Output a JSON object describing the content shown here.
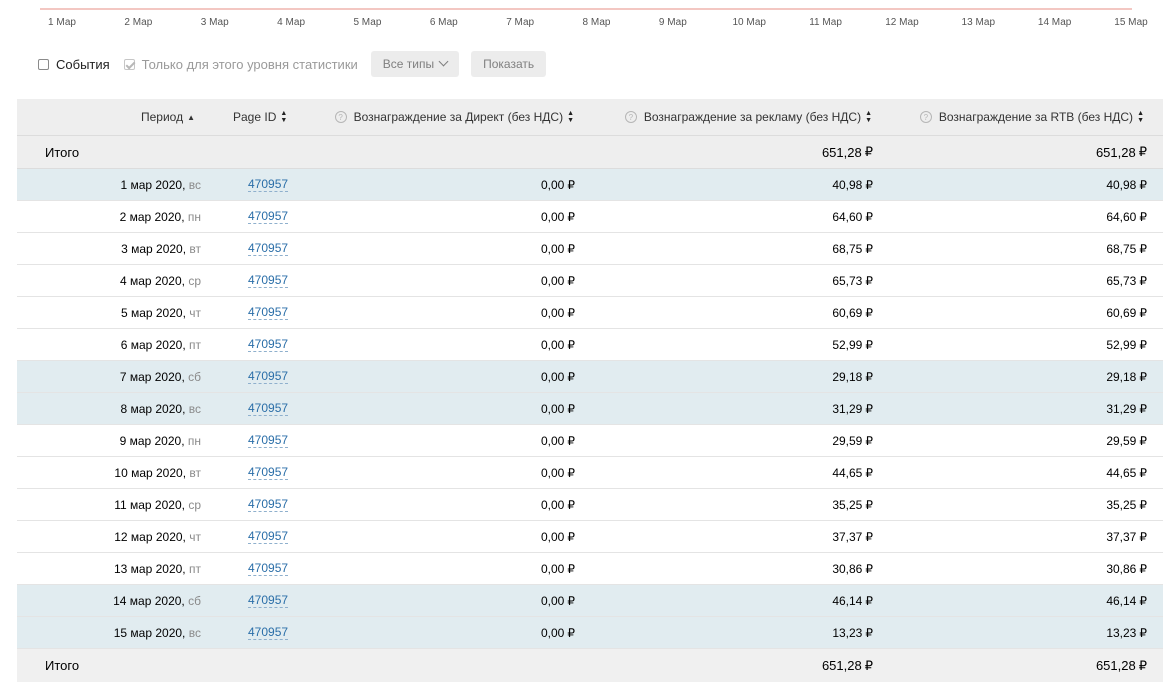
{
  "chart_axis": {
    "ticks": [
      "1 Мар",
      "2 Мар",
      "3 Мар",
      "4 Мар",
      "5 Мар",
      "6 Мар",
      "7 Мар",
      "8 Мар",
      "9 Мар",
      "10 Мар",
      "11 Мар",
      "12 Мар",
      "13 Мар",
      "14 Мар",
      "15 Мар"
    ]
  },
  "controls": {
    "events_label": "События",
    "only_level_label": "Только для этого уровня статистики",
    "types_button": "Все типы",
    "show_button": "Показать"
  },
  "table": {
    "headers": {
      "period": "Период",
      "page_id": "Page ID",
      "direct": "Вознаграждение за Директ (без НДС)",
      "ads": "Вознаграждение за рекламу (без НДС)",
      "rtb": "Вознаграждение за RTB (без НДС)"
    },
    "currency": "₽",
    "total": {
      "label": "Итого",
      "direct": "",
      "ads": "651,28",
      "rtb": "651,28"
    },
    "rows": [
      {
        "date": "1 мар 2020,",
        "day": "вс",
        "page_id": "470957",
        "direct": "0,00",
        "ads": "40,98",
        "rtb": "40,98",
        "weekend": true
      },
      {
        "date": "2 мар 2020,",
        "day": "пн",
        "page_id": "470957",
        "direct": "0,00",
        "ads": "64,60",
        "rtb": "64,60",
        "weekend": false
      },
      {
        "date": "3 мар 2020,",
        "day": "вт",
        "page_id": "470957",
        "direct": "0,00",
        "ads": "68,75",
        "rtb": "68,75",
        "weekend": false
      },
      {
        "date": "4 мар 2020,",
        "day": "ср",
        "page_id": "470957",
        "direct": "0,00",
        "ads": "65,73",
        "rtb": "65,73",
        "weekend": false
      },
      {
        "date": "5 мар 2020,",
        "day": "чт",
        "page_id": "470957",
        "direct": "0,00",
        "ads": "60,69",
        "rtb": "60,69",
        "weekend": false
      },
      {
        "date": "6 мар 2020,",
        "day": "пт",
        "page_id": "470957",
        "direct": "0,00",
        "ads": "52,99",
        "rtb": "52,99",
        "weekend": false
      },
      {
        "date": "7 мар 2020,",
        "day": "сб",
        "page_id": "470957",
        "direct": "0,00",
        "ads": "29,18",
        "rtb": "29,18",
        "weekend": true
      },
      {
        "date": "8 мар 2020,",
        "day": "вс",
        "page_id": "470957",
        "direct": "0,00",
        "ads": "31,29",
        "rtb": "31,29",
        "weekend": true
      },
      {
        "date": "9 мар 2020,",
        "day": "пн",
        "page_id": "470957",
        "direct": "0,00",
        "ads": "29,59",
        "rtb": "29,59",
        "weekend": false
      },
      {
        "date": "10 мар 2020,",
        "day": "вт",
        "page_id": "470957",
        "direct": "0,00",
        "ads": "44,65",
        "rtb": "44,65",
        "weekend": false
      },
      {
        "date": "11 мар 2020,",
        "day": "ср",
        "page_id": "470957",
        "direct": "0,00",
        "ads": "35,25",
        "rtb": "35,25",
        "weekend": false
      },
      {
        "date": "12 мар 2020,",
        "day": "чт",
        "page_id": "470957",
        "direct": "0,00",
        "ads": "37,37",
        "rtb": "37,37",
        "weekend": false
      },
      {
        "date": "13 мар 2020,",
        "day": "пт",
        "page_id": "470957",
        "direct": "0,00",
        "ads": "30,86",
        "rtb": "30,86",
        "weekend": false
      },
      {
        "date": "14 мар 2020,",
        "day": "сб",
        "page_id": "470957",
        "direct": "0,00",
        "ads": "46,14",
        "rtb": "46,14",
        "weekend": true
      },
      {
        "date": "15 мар 2020,",
        "day": "вс",
        "page_id": "470957",
        "direct": "0,00",
        "ads": "13,23",
        "rtb": "13,23",
        "weekend": true
      }
    ]
  }
}
